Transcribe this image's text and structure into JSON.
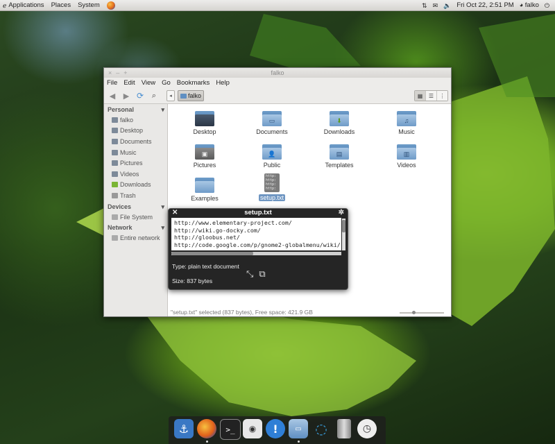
{
  "top_panel": {
    "menus": [
      "Applications",
      "Places",
      "System"
    ],
    "datetime": "Fri Oct 22,  2:51 PM",
    "user": "falko"
  },
  "window": {
    "title": "falko",
    "menubar": [
      "File",
      "Edit",
      "View",
      "Go",
      "Bookmarks",
      "Help"
    ],
    "path_button": "falko",
    "sidebar": {
      "personal_header": "Personal",
      "personal_items": [
        "falko",
        "Desktop",
        "Documents",
        "Music",
        "Pictures",
        "Videos",
        "Downloads",
        "Trash"
      ],
      "devices_header": "Devices",
      "devices_items": [
        "File System"
      ],
      "network_header": "Network",
      "network_items": [
        "Entire network"
      ]
    },
    "files": [
      "Desktop",
      "Documents",
      "Downloads",
      "Music",
      "Pictures",
      "Public",
      "Templates",
      "Videos",
      "Examples",
      "setup.txt"
    ],
    "selected_file": "setup.txt",
    "status": "\"setup.txt\" selected (837 bytes), Free space: 421.9 GB",
    "zoom_level": 0.3
  },
  "preview": {
    "title": "setup.txt",
    "lines": [
      "http://www.elementary-project.com/",
      "http://wiki.go-docky.com/",
      "http://gloobus.net/",
      "http://code.google.com/p/gnome2-globalmenu/wiki/"
    ],
    "type_text": "Type: plain text document",
    "size_text": "Size: 837 bytes"
  },
  "dock": {
    "items": [
      "anchor-icon",
      "firefox-icon",
      "terminal-icon",
      "media-player-icon",
      "notification-icon",
      "file-manager-icon",
      "ubuntu-one-icon",
      "trash-icon",
      "clock-icon"
    ]
  }
}
